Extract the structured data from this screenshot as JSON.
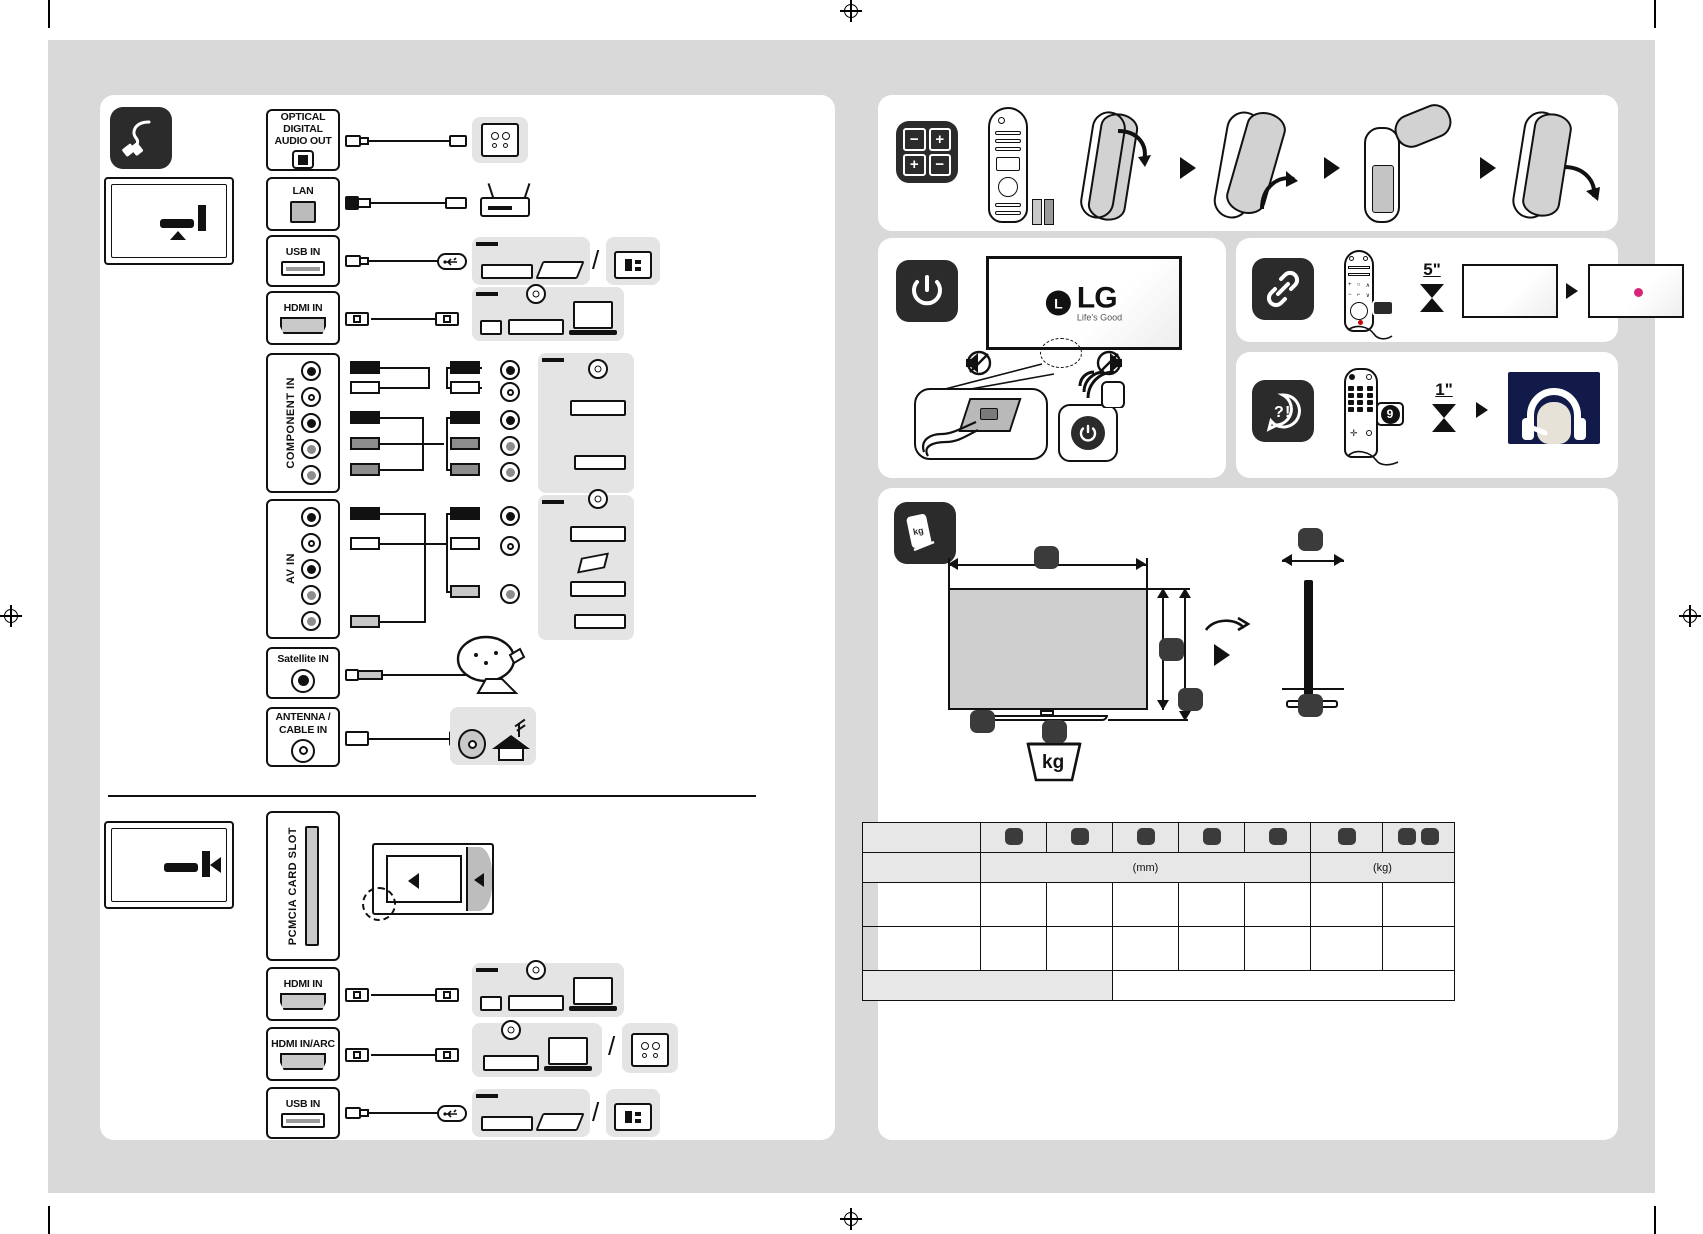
{
  "document": {
    "type": "quick-setup-guide",
    "brand": "LG",
    "brand_tagline": "Life's Good"
  },
  "connections_panel": {
    "icon_name": "cable-plug-icon",
    "tv_view_label": "tv-rear-bottom-view",
    "rear_ports": [
      {
        "id": "optical",
        "label": "OPTICAL DIGITAL\nAUDIO OUT",
        "label_lines": [
          "OPTICAL DIGITAL",
          "AUDIO OUT"
        ],
        "jack": "optical-square-jack",
        "devices": [
          "speaker-system"
        ]
      },
      {
        "id": "lan",
        "label": "LAN",
        "label_lines": [
          "LAN"
        ],
        "jack": "rj45-jack",
        "devices": [
          "router"
        ]
      },
      {
        "id": "usb",
        "label": "USB IN",
        "label_lines": [
          "USB IN"
        ],
        "jack": "usb-a-jack",
        "devices": [
          "external-hdd",
          "usb-flash-drive",
          "card-reader"
        ]
      },
      {
        "id": "hdmi",
        "label": "HDMI IN",
        "label_lines": [
          "HDMI IN"
        ],
        "jack": "hdmi-jack",
        "devices": [
          "set-top-box",
          "dvd-player",
          "laptop"
        ]
      },
      {
        "id": "component",
        "label": "COMPONENT IN",
        "label_lines": [
          "COMPONENT IN"
        ],
        "jack": "rca-jack-group",
        "devices": [
          "dvd-player",
          "set-top-box"
        ]
      },
      {
        "id": "av",
        "label": "AV IN",
        "label_lines": [
          "AV IN"
        ],
        "jack": "rca-jack-group",
        "devices": [
          "dvd-player",
          "camcorder",
          "vcr"
        ]
      },
      {
        "id": "satellite",
        "label": "Satellite IN",
        "label_lines": [
          "Satellite IN"
        ],
        "jack": "coax-jack",
        "devices": [
          "satellite-dish"
        ]
      },
      {
        "id": "antenna",
        "label": "ANTENNA /\nCABLE IN",
        "label_lines": [
          "ANTENNA /",
          "CABLE IN"
        ],
        "jack": "coax-jack",
        "devices": [
          "cable-reel",
          "house-antenna"
        ]
      }
    ],
    "side_ports": [
      {
        "id": "pcmcia",
        "label": "PCMCIA CARD SLOT",
        "label_lines": [
          "PCMCIA CARD SLOT"
        ],
        "jack": "card-slot",
        "devices": [
          "ci-module-card"
        ]
      },
      {
        "id": "hdmi-side",
        "label": "HDMI IN",
        "label_lines": [
          "HDMI IN"
        ],
        "jack": "hdmi-jack",
        "devices": [
          "set-top-box",
          "dvd-player",
          "laptop"
        ]
      },
      {
        "id": "hdmi-arc",
        "label": "HDMI IN/ARC",
        "label_lines": [
          "HDMI IN/ARC"
        ],
        "jack": "hdmi-jack",
        "devices": [
          "dvd-player",
          "laptop",
          "speaker-system"
        ]
      },
      {
        "id": "usb-side",
        "label": "USB IN",
        "label_lines": [
          "USB IN"
        ],
        "jack": "usb-a-jack",
        "devices": [
          "external-hdd",
          "usb-flash-drive",
          "card-reader"
        ]
      }
    ],
    "separator": "section-divider"
  },
  "battery_panel": {
    "icon_name": "battery-polarity-icon",
    "polarity": [
      "−",
      "+",
      "+",
      "−"
    ],
    "steps": [
      {
        "id": "step-1",
        "name": "magic-remote-with-batteries"
      },
      {
        "id": "step-2",
        "name": "remote-back-cover-slide-down"
      },
      {
        "id": "step-3",
        "name": "remote-cover-lift-open"
      },
      {
        "id": "step-4",
        "name": "remote-battery-compartment-open"
      },
      {
        "id": "step-5",
        "name": "remote-cover-close"
      }
    ],
    "arrow": "▶"
  },
  "power_panel": {
    "icon_name": "power-icon",
    "screen_logo": "LG",
    "screen_tagline": "Life's Good",
    "joystick_label": "tv-joystick-button",
    "remote_power_label": "remote-power-button",
    "no_signal_icons": [
      "no-sound-left-icon",
      "no-sound-right-icon"
    ]
  },
  "pairing_panel": {
    "icon_name": "link-icon",
    "hold_time": "5\"",
    "wheel_key_label": "wheel-ok-button",
    "arrow": "▶",
    "result": "tv-paired-indicator"
  },
  "help_panel": {
    "icon_name": "question-exclamation-icon",
    "key": "9",
    "hold_time": "1\"",
    "arrow": "▶",
    "result": "customer-support-agent"
  },
  "dimensions_panel": {
    "icon_name": "dimensions-weight-icon",
    "weight_unit": "kg",
    "front_view_label": "tv-front-dimensions",
    "side_view_label": "tv-side-dimensions",
    "rotate_label": "rotate-view-arrow",
    "arrow": "▶",
    "markers": [
      "width",
      "height-with-stand",
      "height-without-stand",
      "stand-depth",
      "depth",
      "weight"
    ]
  },
  "spec_table": {
    "units": {
      "length": "(mm)",
      "weight": "(kg)"
    },
    "header_markers": [
      "marker-1",
      "marker-2",
      "marker-3",
      "marker-4",
      "marker-5",
      "marker-6",
      "marker-7",
      "marker-8"
    ],
    "column_count": 9,
    "rows": [
      {
        "label": "",
        "cells": [
          "",
          "",
          "",
          "",
          "",
          "",
          "",
          ""
        ]
      },
      {
        "label": "",
        "cells": [
          "",
          "",
          "",
          "",
          "",
          "",
          "",
          ""
        ]
      }
    ],
    "footer_row": {
      "left": "",
      "right": ""
    }
  }
}
